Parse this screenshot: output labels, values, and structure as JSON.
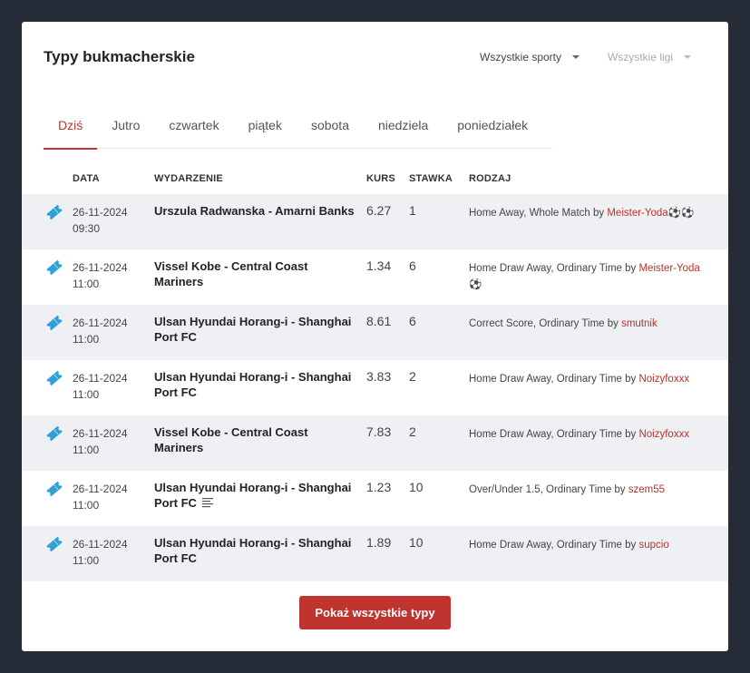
{
  "header": {
    "title": "Typy bukmacherskie",
    "sport_filter": "Wszystkie sporty",
    "league_filter": "Wszystkie ligi"
  },
  "tabs": [
    {
      "label": "Dziś",
      "active": true
    },
    {
      "label": "Jutro",
      "active": false
    },
    {
      "label": "czwartek",
      "active": false
    },
    {
      "label": "piątek",
      "active": false
    },
    {
      "label": "sobota",
      "active": false
    },
    {
      "label": "niedziela",
      "active": false
    },
    {
      "label": "poniedziałek",
      "active": false
    }
  ],
  "columns": {
    "date": "DATA",
    "event": "WYDARZENIE",
    "odds": "KURS",
    "stake": "STAWKA",
    "kind": "RODZAJ"
  },
  "rows": [
    {
      "date": "26-11-2024",
      "time": "09:30",
      "event": "Urszula Radwanska - Amarni Banks",
      "odds": "6.27",
      "stake": "1",
      "kind": "Home Away, Whole Match by ",
      "tipster": "Meister-Yoda⚽⚽",
      "has_notes": false
    },
    {
      "date": "26-11-2024",
      "time": "11:00",
      "event": "Vissel Kobe - Central Coast Mariners",
      "odds": "1.34",
      "stake": "6",
      "kind": "Home Draw Away, Ordinary Time by ",
      "tipster": "Meister-Yoda⚽",
      "has_notes": false
    },
    {
      "date": "26-11-2024",
      "time": "11:00",
      "event": "Ulsan Hyundai Horang-i - Shanghai Port FC",
      "odds": "8.61",
      "stake": "6",
      "kind": "Correct Score, Ordinary Time by ",
      "tipster": "smutnik",
      "has_notes": false
    },
    {
      "date": "26-11-2024",
      "time": "11:00",
      "event": "Ulsan Hyundai Horang-i - Shanghai Port FC",
      "odds": "3.83",
      "stake": "2",
      "kind": "Home Draw Away, Ordinary Time by ",
      "tipster": "Noizyfoxxx",
      "has_notes": false
    },
    {
      "date": "26-11-2024",
      "time": "11:00",
      "event": "Vissel Kobe - Central Coast Mariners",
      "odds": "7.83",
      "stake": "2",
      "kind": "Home Draw Away, Ordinary Time by ",
      "tipster": "Noizyfoxxx",
      "has_notes": false
    },
    {
      "date": "26-11-2024",
      "time": "11:00",
      "event": "Ulsan Hyundai Horang-i - Shanghai Port FC",
      "odds": "1.23",
      "stake": "10",
      "kind": "Over/Under 1.5, Ordinary Time by ",
      "tipster": "szem55",
      "has_notes": true
    },
    {
      "date": "26-11-2024",
      "time": "11:00",
      "event": "Ulsan Hyundai Horang-i - Shanghai Port FC",
      "odds": "1.89",
      "stake": "10",
      "kind": "Home Draw Away, Ordinary Time by ",
      "tipster": "supcio",
      "has_notes": false
    }
  ],
  "footer": {
    "show_all_label": "Pokaż wszystkie typy"
  },
  "colors": {
    "accent": "#c0332f",
    "ticket_icon": "#2f9fd8",
    "background": "#262b38"
  },
  "icons": {
    "row_icon": "ticket-icon",
    "notes": "notes-icon",
    "dropdown": "chevron-down-icon"
  }
}
